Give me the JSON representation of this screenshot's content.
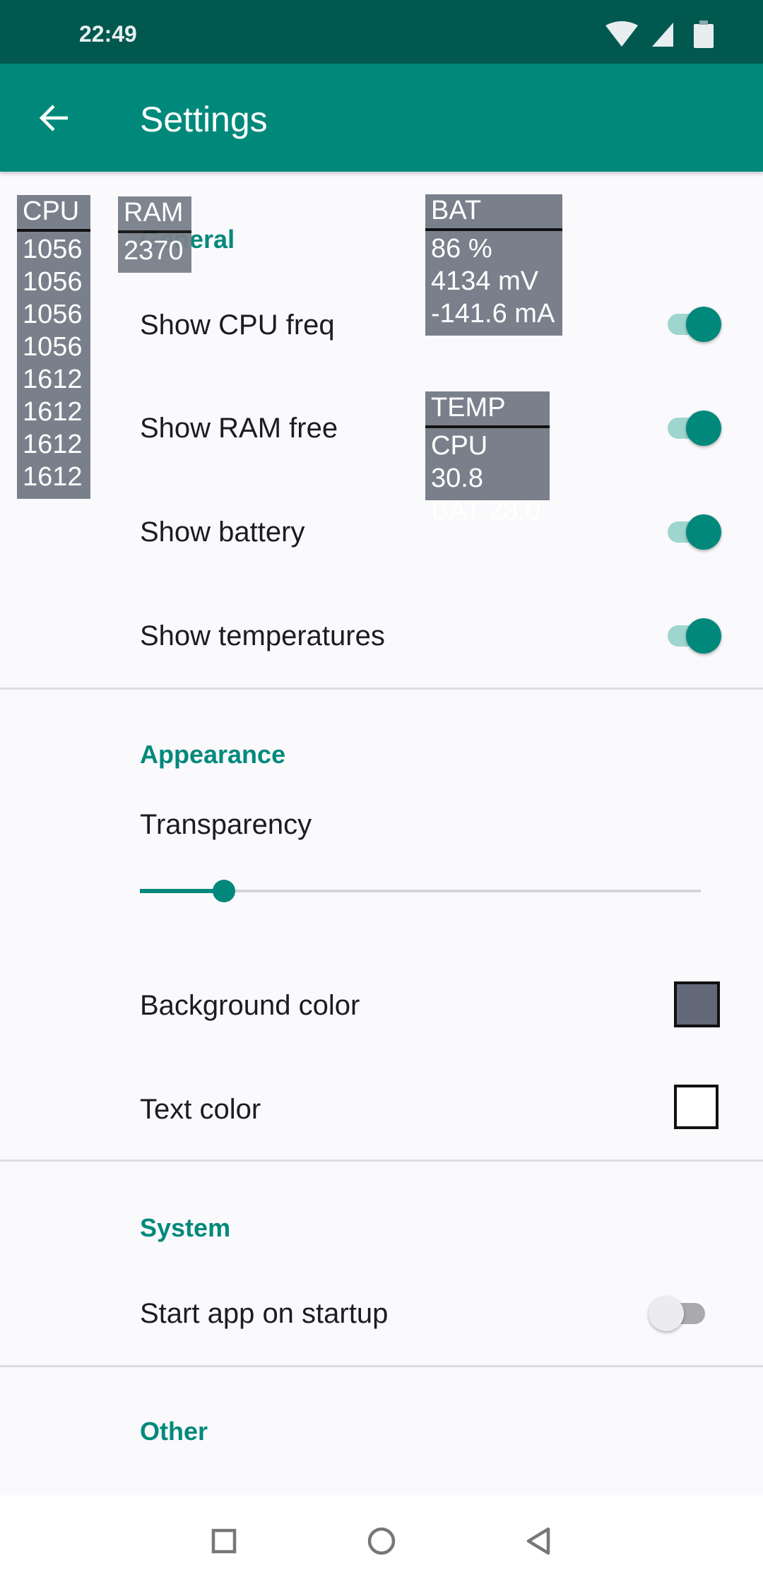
{
  "status_bar": {
    "time": "22:49",
    "icons": [
      "wifi-icon",
      "signal-icon",
      "battery-icon"
    ]
  },
  "app_bar": {
    "title": "Settings",
    "back_icon": "arrow-left-icon"
  },
  "accent": "#00897b",
  "sections": {
    "general": {
      "header": "General",
      "items": [
        {
          "label": "Show CPU freq",
          "on": true
        },
        {
          "label": "Show RAM free",
          "on": true
        },
        {
          "label": "Show battery",
          "on": true
        },
        {
          "label": "Show temperatures",
          "on": true
        }
      ]
    },
    "appearance": {
      "header": "Appearance",
      "transparency_label": "Transparency",
      "transparency_value": 0.15,
      "background_color_label": "Background color",
      "background_color": "#636878",
      "text_color_label": "Text color",
      "text_color": "#ffffff"
    },
    "system": {
      "header": "System",
      "startup_label": "Start app on startup",
      "startup_on": false
    },
    "other": {
      "header": "Other"
    }
  },
  "overlay": {
    "cpu": {
      "title": "CPU",
      "values": [
        "1056",
        "1056",
        "1056",
        "1056",
        "1612",
        "1612",
        "1612",
        "1612"
      ]
    },
    "ram": {
      "title": "RAM",
      "value": "2370"
    },
    "bat": {
      "title": "BAT",
      "values": [
        "86 %",
        "4134 mV",
        "-141.6 mA"
      ]
    },
    "temp": {
      "title": "TEMP",
      "values": [
        "CPU 30.8",
        "BAT 28.0"
      ]
    }
  },
  "nav_bar": {
    "icons": [
      "recents-square-icon",
      "home-circle-icon",
      "back-triangle-icon"
    ]
  }
}
